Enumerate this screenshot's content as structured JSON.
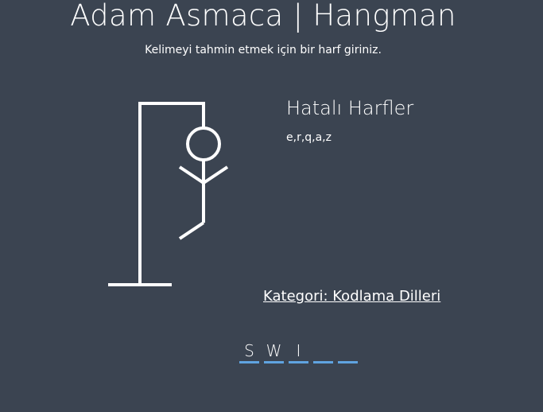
{
  "header": {
    "title": "Adam Asmaca | Hangman",
    "subtitle": "Kelimeyi tahmin etmek için bir harf giriniz."
  },
  "wrong": {
    "title": "Hatalı Harfler",
    "letters": "e,r,q,a,z"
  },
  "category": {
    "label": "Kategori: Kodlama Dilleri"
  },
  "word": {
    "letters": [
      "S",
      "W",
      "I",
      "",
      ""
    ]
  },
  "colors": {
    "background": "#3b4451",
    "foreground": "#ffffff",
    "underline_accent": "#5fa3e0"
  }
}
